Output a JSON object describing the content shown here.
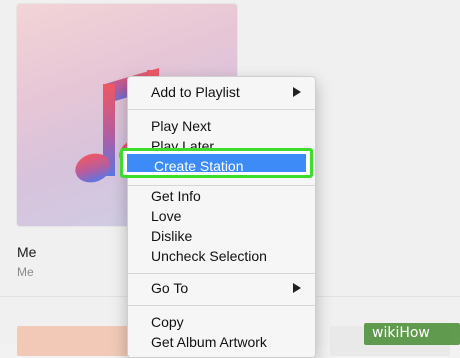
{
  "album": {
    "title": "Me",
    "artist": "Me"
  },
  "context_menu": {
    "items": [
      {
        "label": "Add to Playlist",
        "has_submenu": true
      },
      {
        "label": "Play Next"
      },
      {
        "label": "Play Later"
      },
      {
        "label": "Create Station",
        "highlighted": true
      },
      {
        "label": "Get Info"
      },
      {
        "label": "Love"
      },
      {
        "label": "Dislike"
      },
      {
        "label": "Uncheck Selection"
      },
      {
        "label": "Go To",
        "has_submenu": true
      },
      {
        "label": "Copy"
      },
      {
        "label": "Get Album Artwork"
      }
    ]
  },
  "colors": {
    "highlight": "#3d8bf6",
    "annotation_border": "#3bdc2a",
    "note_icon_top": "#e8505b",
    "note_icon_bottom": "#5b6fe0"
  },
  "watermark": {
    "text": "wikiHow"
  }
}
